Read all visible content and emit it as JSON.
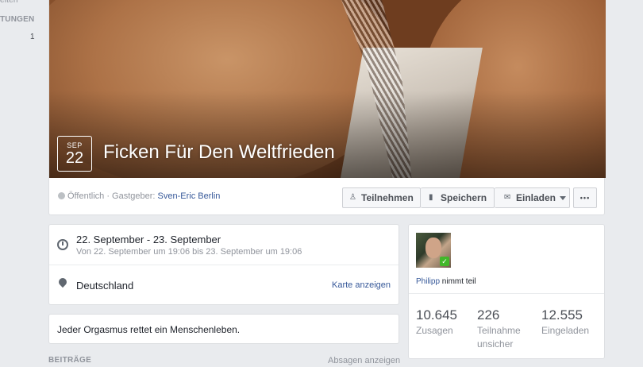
{
  "sidebar_fragment": {
    "top_text": "eiten",
    "heading": "TUNGEN",
    "count": "1"
  },
  "event": {
    "month": "SEP",
    "day": "22",
    "title": "Ficken Für Den Weltfrieden",
    "privacy": "Öffentlich",
    "host_prefix": " · Gastgeber: ",
    "host_name": "Sven-Eric Berlin"
  },
  "actions": {
    "join": "Teilnehmen",
    "save": "Speichern",
    "invite": "Einladen",
    "more": "•••"
  },
  "details": {
    "date_main": "22. September - 23. September",
    "date_sub": "Von 22. September um 19:06 bis 23. September um 19:06",
    "location": "Deutschland",
    "map_link": "Karte anzeigen",
    "description": "Jeder Orgasmus rettet ein Menschenleben."
  },
  "footer": {
    "posts_label": "BEITRÄGE",
    "decline_link": "Absagen anzeigen"
  },
  "guests": {
    "friend_name": "Philipp",
    "friend_status": " nimmt teil",
    "stats": [
      {
        "number": "10.645",
        "label": "Zusagen"
      },
      {
        "number": "226",
        "label": "Teilnahme unsicher"
      },
      {
        "number": "12.555",
        "label": "Eingeladen"
      }
    ]
  },
  "icons": {
    "globe": "globe-icon",
    "clock": "clock-icon",
    "pin": "location-pin-icon",
    "join": "join-icon",
    "save": "bookmark-icon",
    "invite": "envelope-icon"
  },
  "colors": {
    "link": "#365899",
    "background": "#e9ebee",
    "check": "#42b72a"
  }
}
